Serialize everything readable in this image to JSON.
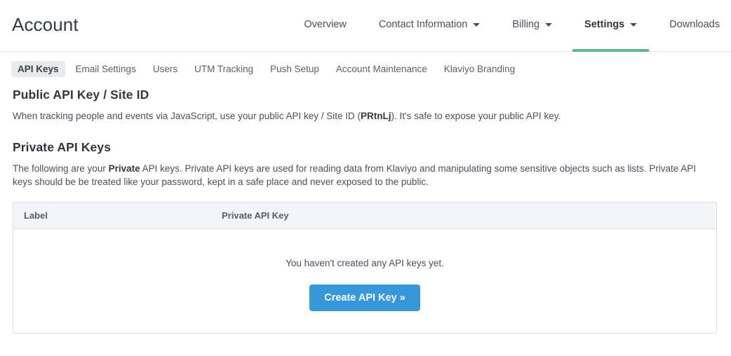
{
  "header": {
    "brand": "Account",
    "nav": [
      {
        "label": "Overview",
        "has_caret": false,
        "active": false
      },
      {
        "label": "Contact Information",
        "has_caret": true,
        "active": false
      },
      {
        "label": "Billing",
        "has_caret": true,
        "active": false
      },
      {
        "label": "Settings",
        "has_caret": true,
        "active": true
      },
      {
        "label": "Downloads",
        "has_caret": false,
        "active": false
      }
    ],
    "active_underline_color": "#5cb98b"
  },
  "subnav": {
    "items": [
      {
        "label": "API Keys",
        "active": true
      },
      {
        "label": "Email Settings",
        "active": false
      },
      {
        "label": "Users",
        "active": false
      },
      {
        "label": "UTM Tracking",
        "active": false
      },
      {
        "label": "Push Setup",
        "active": false
      },
      {
        "label": "Account Maintenance",
        "active": false
      },
      {
        "label": "Klaviyo Branding",
        "active": false
      }
    ]
  },
  "public_section": {
    "title": "Public API Key / Site ID",
    "text_before": "When tracking people and events via JavaScript, use your public API key / Site ID (",
    "site_id": "PRtnLj",
    "text_after": "). It's safe to expose your public API key."
  },
  "private_section": {
    "title": "Private API Keys",
    "text_part1": "The following are your ",
    "text_bold": "Private",
    "text_part2": " API keys. Private API keys are used for reading data from Klaviyo and manipulating some sensitive objects such as lists. Private API keys should be be treated like your password, kept in a safe place and never exposed to the public."
  },
  "table": {
    "columns": [
      {
        "label": "Label"
      },
      {
        "label": "Private API Key"
      }
    ],
    "rows": [],
    "empty_text": "You haven't created any API keys yet.",
    "create_button": "Create API Key »",
    "create_button_color": "#3498db"
  }
}
